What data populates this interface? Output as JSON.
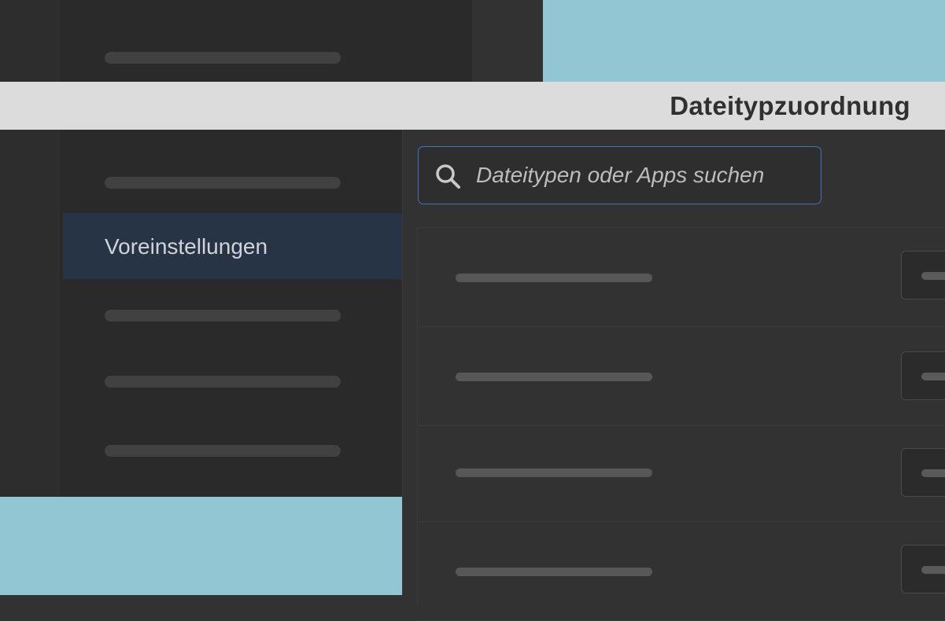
{
  "header": {
    "title": "Dateitypzuordnung"
  },
  "sidebar": {
    "active_item": {
      "label": "Voreinstellungen"
    }
  },
  "search": {
    "placeholder": "Dateitypen oder Apps suchen",
    "icon": "search-icon"
  },
  "colors": {
    "accent": "#3d74c4",
    "active_background": "#263445",
    "header_background": "#dcdcdc",
    "panel_background": "#323232",
    "sidebar_background": "#2a2a2a",
    "backdrop": "#93c6d3"
  }
}
